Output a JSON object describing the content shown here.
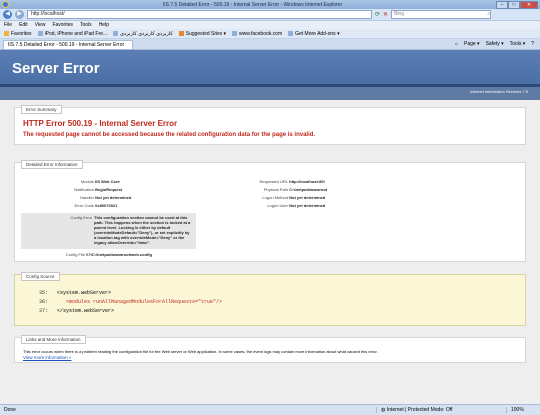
{
  "window": {
    "title": "IIS 7.5 Detailed Error - 500.19 - Internal Server Error - Windows Internet Explorer",
    "minimize": "–",
    "maximize": "□",
    "close": "✕"
  },
  "address": {
    "url": "http://localhost/",
    "search_placeholder": "Bing"
  },
  "menu": [
    "File",
    "Edit",
    "View",
    "Favorites",
    "Tools",
    "Help"
  ],
  "favorites": {
    "label": "Favorites",
    "items": [
      "iPod, iPhone and iPad Fre...",
      "کاربردی کاربردی کاربردی",
      "Suggested Sites ▾",
      "www.facebook.com",
      "Get More Add-ons ▾"
    ]
  },
  "tab": {
    "label": "IIS 7.5 Detailed Error - 500.19 - Internal Server Error"
  },
  "tools": [
    "Page ▾",
    "Safety ▾",
    "Tools ▾",
    "?"
  ],
  "page": {
    "heading": "Server Error",
    "subheading": "Internet Information Services 7.5",
    "summary": {
      "title": "Error Summary",
      "h2": "HTTP Error 500.19 - Internal Server Error",
      "h3": "The requested page cannot be accessed because the related configuration data for the page is invalid."
    },
    "detail": {
      "title": "Detailed Error Information",
      "left": [
        {
          "label": "Module",
          "value": "IIS Web Core"
        },
        {
          "label": "Notification",
          "value": "BeginRequest"
        },
        {
          "label": "Handler",
          "value": "Not yet determined"
        },
        {
          "label": "Error Code",
          "value": "0x80070021"
        }
      ],
      "config_error_label": "Config Error",
      "config_error_value": "This configuration section cannot be used at this path. This happens when the section is locked at a parent level. Locking is either by default (overrideModeDefault=\"Deny\"), or set explicitly by a location tag with overrideMode=\"Deny\" or the legacy allowOverride=\"false\".",
      "config_file_label": "Config File",
      "config_file_value": "\\\\?\\C:\\inetpub\\wwwroot\\web.config",
      "right": [
        {
          "label": "Requested URL",
          "value": "http://localhost:80/"
        },
        {
          "label": "Physical Path",
          "value": "C:\\inetpub\\wwwroot"
        },
        {
          "label": "Logon Method",
          "value": "Not yet determined"
        },
        {
          "label": "Logon User",
          "value": "Not yet determined"
        }
      ]
    },
    "config_source": {
      "title": "Config Source",
      "lines": [
        {
          "num": "35:",
          "text": "<system.webServer>",
          "highlight": false
        },
        {
          "num": "36:",
          "text": "<modules runAllManagedModulesForAllRequests=\"true\"/>",
          "highlight": true
        },
        {
          "num": "37:",
          "text": "</system.webServer>",
          "highlight": false
        }
      ]
    },
    "links": {
      "title": "Links and More Information",
      "text": "This error occurs when there is a problem reading the configuration file for the Web server or Web application. In some cases, the event logs may contain more information about what caused this error.",
      "link": "View more information »"
    }
  },
  "status": {
    "done": "Done",
    "zone": "Internet | Protected Mode: Off",
    "zoom": "100%"
  }
}
